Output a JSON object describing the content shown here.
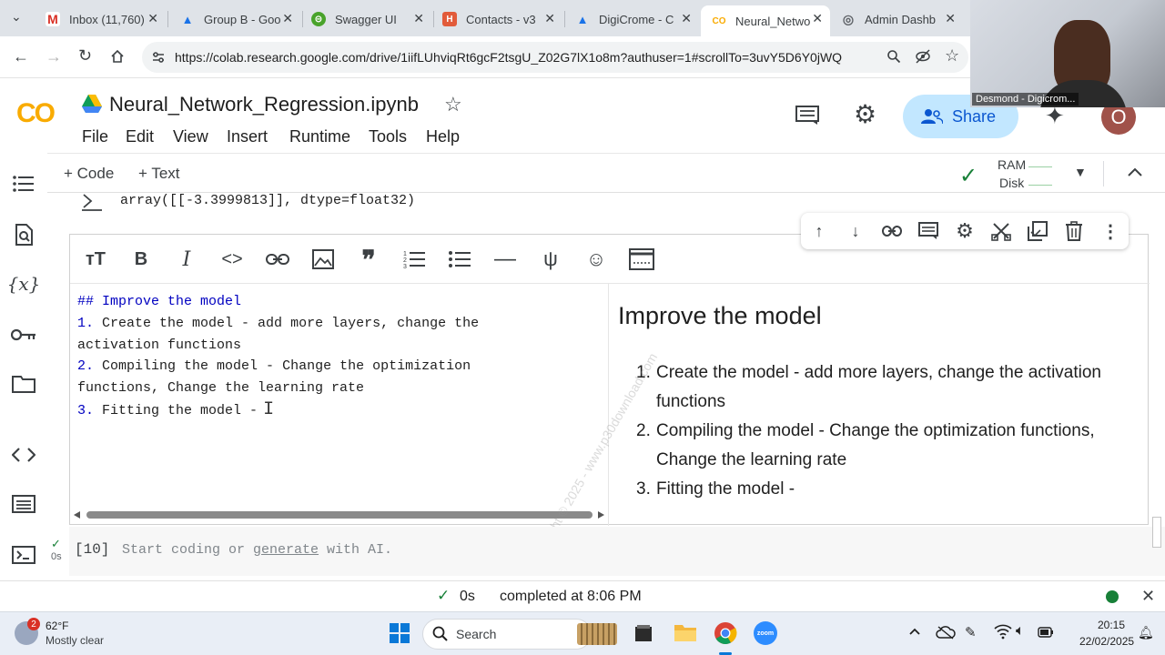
{
  "browser": {
    "tabs": [
      {
        "title": "Inbox (11,760)",
        "color": "#d93025",
        "glyph": "M"
      },
      {
        "title": "Group B - Goo",
        "color": "#1a73e8",
        "glyph": "▲"
      },
      {
        "title": "Swagger UI",
        "color": "#49a32b",
        "glyph": "⊝"
      },
      {
        "title": "Contacts - v3",
        "color": "#e25b3a",
        "glyph": "H"
      },
      {
        "title": "DigiCrome - C",
        "color": "#1a73e8",
        "glyph": "▲"
      },
      {
        "title": "Neural_Netwo",
        "color": "#f9ab00",
        "glyph": "CO"
      },
      {
        "title": "Admin Dashb",
        "color": "#5f6368",
        "glyph": "◎"
      }
    ],
    "url": "https://colab.research.google.com/drive/1iifLUhviqRt6gcF2tsgU_Z02G7lX1o8m?authuser=1#scrollTo=3uvY5D6Y0jWQ"
  },
  "colab": {
    "logo": "CO",
    "notebook_title": "Neural_Network_Regression.ipynb",
    "menu": [
      "File",
      "Edit",
      "View",
      "Insert",
      "Runtime",
      "Tools",
      "Help"
    ],
    "share_label": "Share",
    "avatar_letter": "O",
    "toolbar": {
      "code_label": "+ Code",
      "text_label": "+ Text",
      "ram_label": "RAM",
      "disk_label": "Disk"
    }
  },
  "notebook": {
    "prev_output": "array([[-3.3999813]], dtype=float32)",
    "editor_lines": [
      "## Improve the model",
      "1. Create the model - add more layers, change the",
      "activation functions",
      "2. Compiling the model - Change the optimization",
      "functions, Change the learning rate",
      "3. Fitting the model -"
    ],
    "preview": {
      "heading": "Improve the model",
      "items": [
        {
          "num": "1.",
          "text": "Create the model - add more layers, change the activation functions"
        },
        {
          "num": "2.",
          "text": "Compiling the model - Change the optimization functions, Change the learning rate"
        },
        {
          "num": "3.",
          "text": "Fitting the model -"
        }
      ]
    },
    "next_cell": {
      "exec_count": "[10]",
      "placeholder_start": "Start coding or ",
      "placeholder_link": "generate",
      "placeholder_end": " with AI.",
      "exec_time": "0s"
    }
  },
  "status": {
    "duration": "0s",
    "completed_text": "completed at 8:06 PM"
  },
  "taskbar": {
    "weather_temp": "62°F",
    "weather_desc": "Mostly clear",
    "weather_badge": "2",
    "search_label": "Search",
    "time": "20:15",
    "date": "22/02/2025"
  },
  "webcam": {
    "label": "Desmond - Digicrom..."
  },
  "watermark": "Copyright © 2025 - www.p30download.com"
}
